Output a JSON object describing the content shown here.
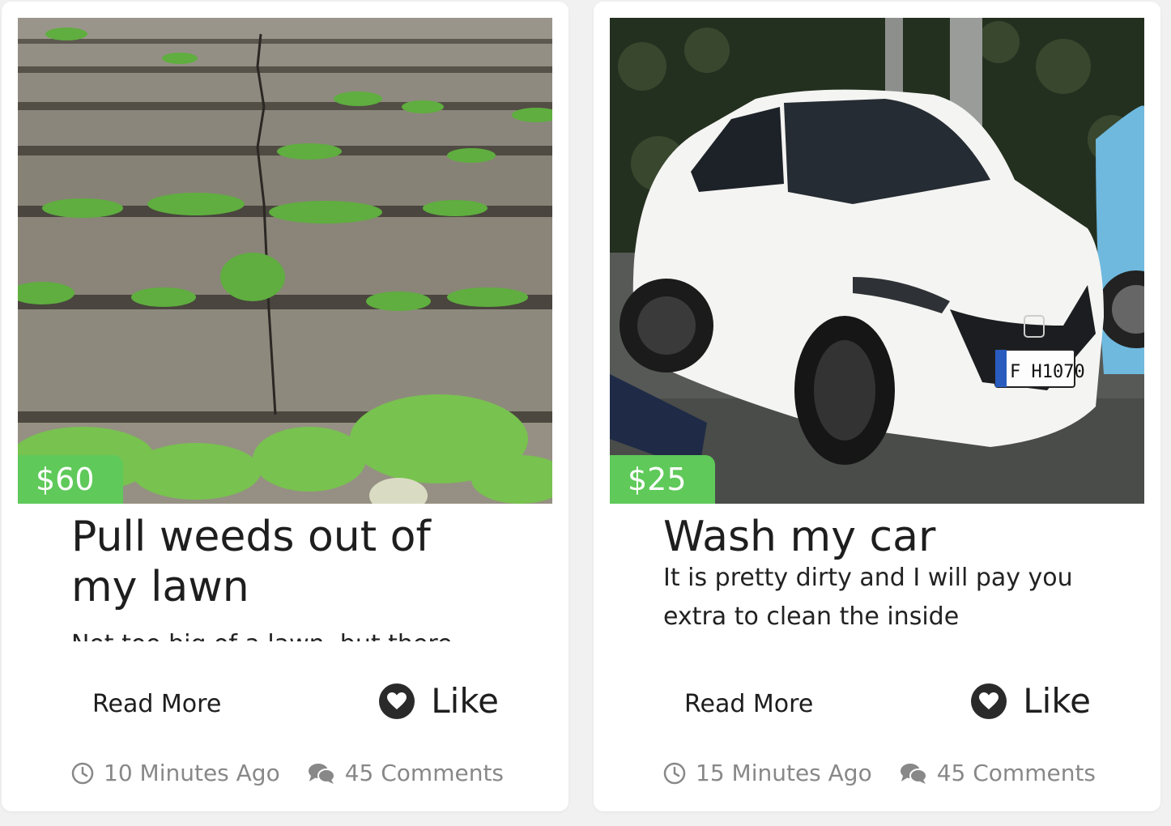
{
  "cards": [
    {
      "price": "$60",
      "title": "Pull weeds out of my lawn",
      "description": "Not too big of a lawn, but there",
      "read_more": "Read More",
      "like": "Like",
      "time": "10 Minutes Ago",
      "comments": "45 Comments",
      "image": "stone-steps-with-weeds"
    },
    {
      "price": "$25",
      "title": "Wash my car",
      "description": "It is pretty dirty and I will pay you extra to clean the inside",
      "read_more": "Read More",
      "like": "Like",
      "time": "15 Minutes Ago",
      "comments": "45 Comments",
      "image": "white-car",
      "plate": "F H1070"
    }
  ],
  "colors": {
    "price_badge": "#5fc95a",
    "background": "#f1f1f1",
    "card": "#ffffff",
    "meta_text": "#888888"
  },
  "icons": [
    "clock-icon",
    "comments-icon",
    "heart-icon"
  ]
}
